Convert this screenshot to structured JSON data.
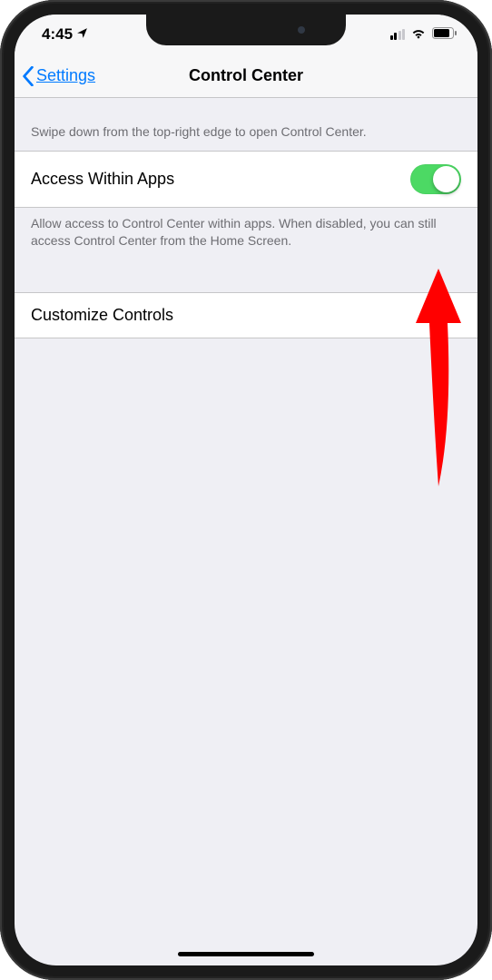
{
  "status_bar": {
    "time": "4:45",
    "location_icon": "location-arrow"
  },
  "nav": {
    "back_label": "Settings",
    "title": "Control Center"
  },
  "section1": {
    "header": "Swipe down from the top-right edge to open Control Center.",
    "row_label": "Access Within Apps",
    "toggle_on": true,
    "footer": "Allow access to Control Center within apps. When disabled, you can still access Control Center from the Home Screen."
  },
  "section2": {
    "row_label": "Customize Controls"
  },
  "colors": {
    "accent": "#007aff",
    "toggle_on": "#4cd964",
    "annotation_arrow": "#ff0000"
  }
}
